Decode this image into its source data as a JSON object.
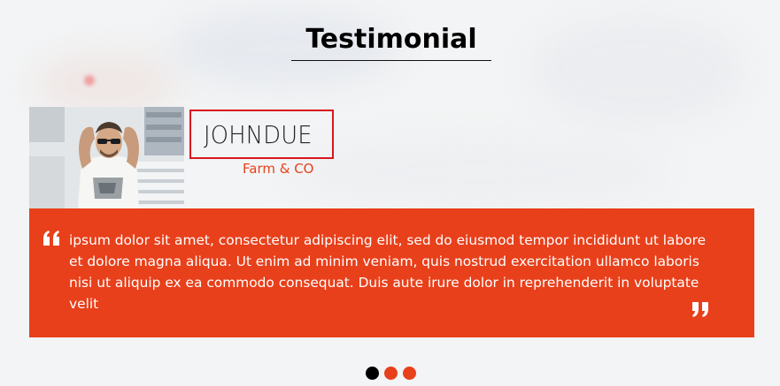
{
  "section": {
    "title": "Testimonial"
  },
  "testimonial": {
    "name": "JOHNDUE",
    "company": "Farm & CO",
    "quote": "ipsum dolor sit amet, consectetur adipiscing elit, sed do eiusmod tempor incididunt ut labore et dolore magna aliqua. Ut enim ad minim veniam, quis nostrud exercitation ullamco laboris nisi ut aliquip ex ea commodo consequat. Duis aute irure dolor in reprehenderit in voluptate velit"
  },
  "carousel": {
    "dots": 3,
    "active_index": 0
  },
  "colors": {
    "accent": "#e8401b",
    "highlight_border": "#d8161e",
    "heading": "#000000",
    "background": "#f3f4f5"
  },
  "icons": {
    "open_quote": "quote-open-icon",
    "close_quote": "quote-close-icon"
  }
}
